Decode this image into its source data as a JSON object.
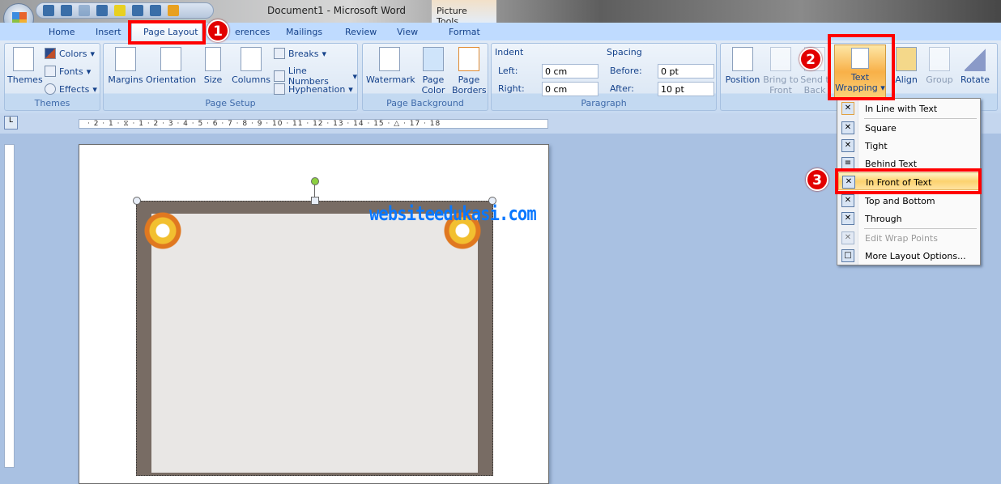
{
  "window": {
    "title": "Document1 - Microsoft Word",
    "contextual_tab": "Picture Tools"
  },
  "tabs": [
    "Home",
    "Insert",
    "Page Layout",
    "References",
    "Mailings",
    "Review",
    "View",
    "Format"
  ],
  "tabs_visible": {
    "references_partial": "erences"
  },
  "ribbon": {
    "themes": {
      "label": "Themes",
      "themes_btn": "Themes",
      "colors": "Colors",
      "fonts": "Fonts",
      "effects": "Effects"
    },
    "page_setup": {
      "label": "Page Setup",
      "margins": "Margins",
      "orientation": "Orientation",
      "size": "Size",
      "columns": "Columns",
      "breaks": "Breaks",
      "line_numbers": "Line Numbers",
      "hyphenation": "Hyphenation"
    },
    "page_background": {
      "label": "Page Background",
      "watermark": "Watermark",
      "page_color_1": "Page",
      "page_color_2": "Color",
      "page_borders_1": "Page",
      "page_borders_2": "Borders"
    },
    "paragraph": {
      "label": "Paragraph",
      "indent": "Indent",
      "left_label": "Left:",
      "left_value": "0 cm",
      "right_label": "Right:",
      "right_value": "0 cm",
      "spacing": "Spacing",
      "before_label": "Before:",
      "before_value": "0 pt",
      "after_label": "After:",
      "after_value": "10 pt"
    },
    "arrange": {
      "position": "Position",
      "bring_1": "Bring to",
      "bring_2": "Front",
      "send_1": "Send t",
      "send_2": "Back",
      "wrap_1": "Text",
      "wrap_2": "Wrapping",
      "align": "Align",
      "group": "Group",
      "rotate": "Rotate"
    }
  },
  "ruler": {
    "tab_selector": "L",
    "ticks": "· 2 · 1 · ⧖ · 1 · 2 · 3 · 4 · 5 · 6 · 7 · 8 · 9 · 10 · 11 · 12 · 13 · 14 · 15 · △ · 17 · 18"
  },
  "document": {
    "watermark_text": "websiteedukasi.com"
  },
  "menu": {
    "items": [
      {
        "label": "In Line with Text",
        "icon": "wrap-inline-icon"
      },
      {
        "label": "Square",
        "icon": "wrap-square-icon"
      },
      {
        "label": "Tight",
        "icon": "wrap-tight-icon"
      },
      {
        "label": "Behind Text",
        "icon": "wrap-behind-icon"
      },
      {
        "label": "In Front of Text",
        "icon": "wrap-front-icon"
      },
      {
        "label": "Top and Bottom",
        "icon": "wrap-topbottom-icon"
      },
      {
        "label": "Through",
        "icon": "wrap-through-icon"
      },
      {
        "label": "Edit Wrap Points",
        "icon": "edit-wrap-points-icon"
      },
      {
        "label": "More Layout Options...",
        "icon": "layout-options-icon"
      }
    ]
  },
  "annotations": {
    "step1": "1",
    "step2": "2",
    "step3": "3",
    "color": "#ff0000"
  }
}
